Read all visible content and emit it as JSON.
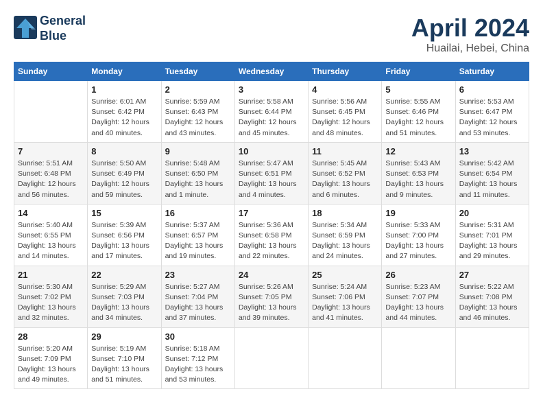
{
  "header": {
    "logo_line1": "General",
    "logo_line2": "Blue",
    "month_title": "April 2024",
    "location": "Huailai, Hebei, China"
  },
  "weekdays": [
    "Sunday",
    "Monday",
    "Tuesday",
    "Wednesday",
    "Thursday",
    "Friday",
    "Saturday"
  ],
  "weeks": [
    [
      {
        "day": "",
        "info": ""
      },
      {
        "day": "1",
        "info": "Sunrise: 6:01 AM\nSunset: 6:42 PM\nDaylight: 12 hours\nand 40 minutes."
      },
      {
        "day": "2",
        "info": "Sunrise: 5:59 AM\nSunset: 6:43 PM\nDaylight: 12 hours\nand 43 minutes."
      },
      {
        "day": "3",
        "info": "Sunrise: 5:58 AM\nSunset: 6:44 PM\nDaylight: 12 hours\nand 45 minutes."
      },
      {
        "day": "4",
        "info": "Sunrise: 5:56 AM\nSunset: 6:45 PM\nDaylight: 12 hours\nand 48 minutes."
      },
      {
        "day": "5",
        "info": "Sunrise: 5:55 AM\nSunset: 6:46 PM\nDaylight: 12 hours\nand 51 minutes."
      },
      {
        "day": "6",
        "info": "Sunrise: 5:53 AM\nSunset: 6:47 PM\nDaylight: 12 hours\nand 53 minutes."
      }
    ],
    [
      {
        "day": "7",
        "info": "Sunrise: 5:51 AM\nSunset: 6:48 PM\nDaylight: 12 hours\nand 56 minutes."
      },
      {
        "day": "8",
        "info": "Sunrise: 5:50 AM\nSunset: 6:49 PM\nDaylight: 12 hours\nand 59 minutes."
      },
      {
        "day": "9",
        "info": "Sunrise: 5:48 AM\nSunset: 6:50 PM\nDaylight: 13 hours\nand 1 minute."
      },
      {
        "day": "10",
        "info": "Sunrise: 5:47 AM\nSunset: 6:51 PM\nDaylight: 13 hours\nand 4 minutes."
      },
      {
        "day": "11",
        "info": "Sunrise: 5:45 AM\nSunset: 6:52 PM\nDaylight: 13 hours\nand 6 minutes."
      },
      {
        "day": "12",
        "info": "Sunrise: 5:43 AM\nSunset: 6:53 PM\nDaylight: 13 hours\nand 9 minutes."
      },
      {
        "day": "13",
        "info": "Sunrise: 5:42 AM\nSunset: 6:54 PM\nDaylight: 13 hours\nand 11 minutes."
      }
    ],
    [
      {
        "day": "14",
        "info": "Sunrise: 5:40 AM\nSunset: 6:55 PM\nDaylight: 13 hours\nand 14 minutes."
      },
      {
        "day": "15",
        "info": "Sunrise: 5:39 AM\nSunset: 6:56 PM\nDaylight: 13 hours\nand 17 minutes."
      },
      {
        "day": "16",
        "info": "Sunrise: 5:37 AM\nSunset: 6:57 PM\nDaylight: 13 hours\nand 19 minutes."
      },
      {
        "day": "17",
        "info": "Sunrise: 5:36 AM\nSunset: 6:58 PM\nDaylight: 13 hours\nand 22 minutes."
      },
      {
        "day": "18",
        "info": "Sunrise: 5:34 AM\nSunset: 6:59 PM\nDaylight: 13 hours\nand 24 minutes."
      },
      {
        "day": "19",
        "info": "Sunrise: 5:33 AM\nSunset: 7:00 PM\nDaylight: 13 hours\nand 27 minutes."
      },
      {
        "day": "20",
        "info": "Sunrise: 5:31 AM\nSunset: 7:01 PM\nDaylight: 13 hours\nand 29 minutes."
      }
    ],
    [
      {
        "day": "21",
        "info": "Sunrise: 5:30 AM\nSunset: 7:02 PM\nDaylight: 13 hours\nand 32 minutes."
      },
      {
        "day": "22",
        "info": "Sunrise: 5:29 AM\nSunset: 7:03 PM\nDaylight: 13 hours\nand 34 minutes."
      },
      {
        "day": "23",
        "info": "Sunrise: 5:27 AM\nSunset: 7:04 PM\nDaylight: 13 hours\nand 37 minutes."
      },
      {
        "day": "24",
        "info": "Sunrise: 5:26 AM\nSunset: 7:05 PM\nDaylight: 13 hours\nand 39 minutes."
      },
      {
        "day": "25",
        "info": "Sunrise: 5:24 AM\nSunset: 7:06 PM\nDaylight: 13 hours\nand 41 minutes."
      },
      {
        "day": "26",
        "info": "Sunrise: 5:23 AM\nSunset: 7:07 PM\nDaylight: 13 hours\nand 44 minutes."
      },
      {
        "day": "27",
        "info": "Sunrise: 5:22 AM\nSunset: 7:08 PM\nDaylight: 13 hours\nand 46 minutes."
      }
    ],
    [
      {
        "day": "28",
        "info": "Sunrise: 5:20 AM\nSunset: 7:09 PM\nDaylight: 13 hours\nand 49 minutes."
      },
      {
        "day": "29",
        "info": "Sunrise: 5:19 AM\nSunset: 7:10 PM\nDaylight: 13 hours\nand 51 minutes."
      },
      {
        "day": "30",
        "info": "Sunrise: 5:18 AM\nSunset: 7:12 PM\nDaylight: 13 hours\nand 53 minutes."
      },
      {
        "day": "",
        "info": ""
      },
      {
        "day": "",
        "info": ""
      },
      {
        "day": "",
        "info": ""
      },
      {
        "day": "",
        "info": ""
      }
    ]
  ]
}
